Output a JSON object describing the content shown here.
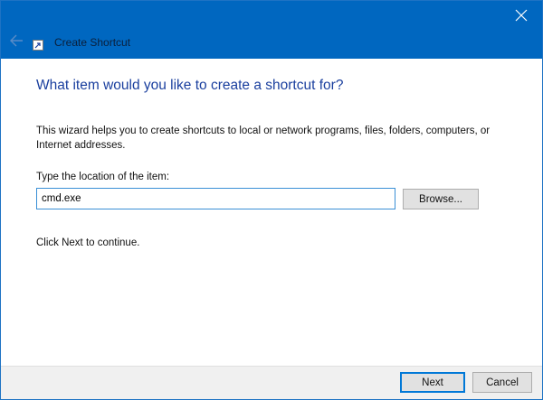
{
  "window": {
    "title": "Create Shortcut",
    "accent_color": "#0067c0"
  },
  "icons": {
    "back": "back-arrow-icon",
    "app": "shortcut-icon",
    "close": "close-icon"
  },
  "main": {
    "heading": "What item would you like to create a shortcut for?",
    "description": "This wizard helps you to create shortcuts to local or network programs, files, folders, computers, or Internet addresses.",
    "location_label": "Type the location of the item:",
    "location_value": "cmd.exe",
    "browse_label": "Browse...",
    "continue_text": "Click Next to continue."
  },
  "footer": {
    "next_label": "Next",
    "cancel_label": "Cancel"
  }
}
